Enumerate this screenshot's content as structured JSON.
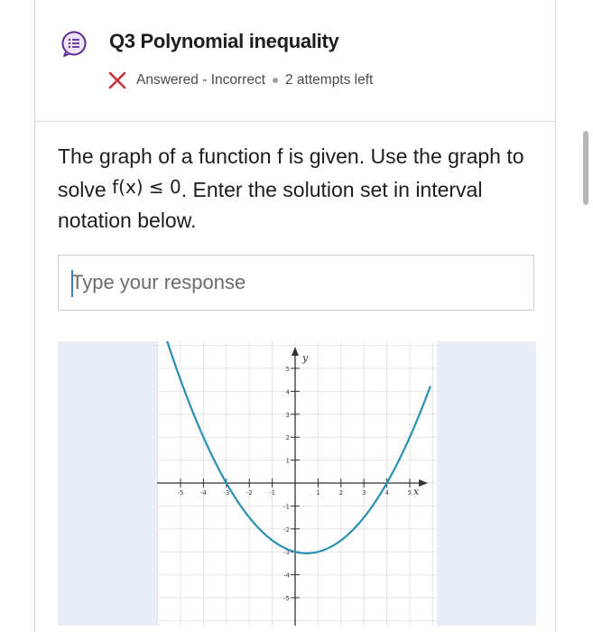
{
  "header": {
    "question_title": "Q3 Polynomial inequality",
    "status_text": "Answered - Incorrect",
    "attempts_text": "2 attempts left"
  },
  "question": {
    "prompt_before": "The graph of a function f is given. Use the graph to solve ",
    "math_expr": "f(x) ≤ 0",
    "prompt_after": ". Enter the solution set in interval notation below."
  },
  "response": {
    "placeholder": "Type your response",
    "value": ""
  },
  "graph": {
    "y_axis_label": "y",
    "x_axis_label": "x",
    "x_ticks": [
      "-5",
      "-4",
      "-3",
      "-2",
      "-1",
      "1",
      "2",
      "3",
      "4",
      "5"
    ],
    "y_ticks": [
      "5",
      "4",
      "3",
      "2",
      "1",
      "-1",
      "-2",
      "-3",
      "-4",
      "-5"
    ],
    "curve_color": "#2a8fb0",
    "x_range": [
      -6,
      6
    ],
    "y_range": [
      -6,
      6
    ]
  },
  "colors": {
    "accent": "#5c2d91",
    "error": "#c4323a"
  },
  "icons": {
    "question_icon": "question-list-icon",
    "status_icon": "x-icon"
  }
}
